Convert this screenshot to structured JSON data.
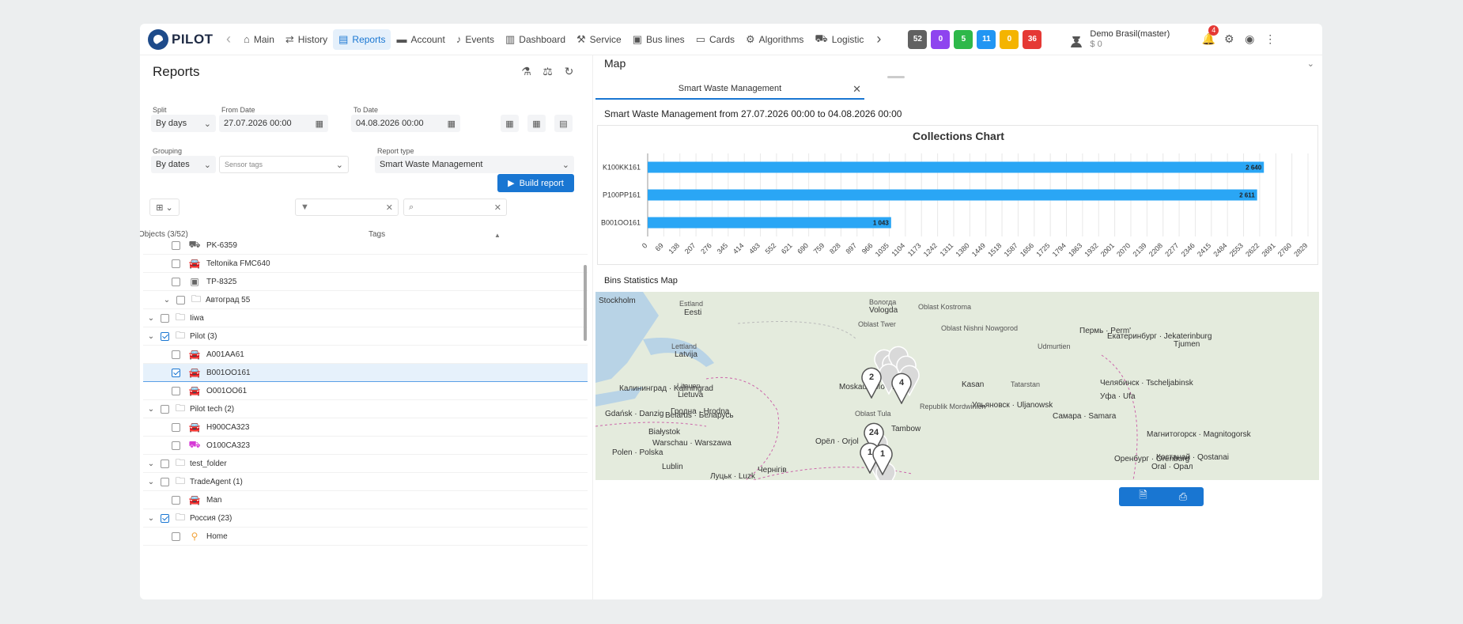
{
  "app": {
    "logo_text": "PILOT"
  },
  "nav": [
    {
      "label": "Main",
      "icon": "home-icon",
      "glyph": "⌂"
    },
    {
      "label": "History",
      "icon": "route-icon",
      "glyph": "⇄"
    },
    {
      "label": "Reports",
      "icon": "report-icon",
      "glyph": "▤",
      "active": true
    },
    {
      "label": "Account",
      "icon": "account-icon",
      "glyph": "▬"
    },
    {
      "label": "Events",
      "icon": "bell-icon",
      "glyph": "♪"
    },
    {
      "label": "Dashboard",
      "icon": "dashboard-icon",
      "glyph": "▥"
    },
    {
      "label": "Service",
      "icon": "wrench-icon",
      "glyph": "⚒"
    },
    {
      "label": "Bus lines",
      "icon": "bus-icon",
      "glyph": "▣"
    },
    {
      "label": "Cards",
      "icon": "card-icon",
      "glyph": "▭"
    },
    {
      "label": "Algorithms",
      "icon": "algorithm-icon",
      "glyph": "⚙"
    },
    {
      "label": "Logistic",
      "icon": "truck-icon",
      "glyph": "⛟"
    }
  ],
  "status_badges": [
    {
      "value": "52",
      "color": "#616161"
    },
    {
      "value": "0",
      "color": "#8e44ef"
    },
    {
      "value": "5",
      "color": "#2eb84a"
    },
    {
      "value": "11",
      "color": "#2196f3"
    },
    {
      "value": "0",
      "color": "#f4b400"
    },
    {
      "value": "36",
      "color": "#e53935"
    }
  ],
  "user": {
    "name": "Demo Brasil(master)",
    "balance": "$ 0",
    "notifications": "4"
  },
  "reports_panel": {
    "title": "Reports",
    "split_label": "Split",
    "split_value": "By days",
    "from_label": "From Date",
    "from_value": "27.07.2026 00:00",
    "to_label": "To Date",
    "to_value": "04.08.2026 00:00",
    "grouping_label": "Grouping",
    "grouping_value": "By dates",
    "sensor_tags_placeholder": "Sensor tags",
    "report_type_label": "Report type",
    "report_type_value": "Smart Waste Management",
    "build_label": "Build report",
    "objects_header": "Objects (3/52)",
    "tags_header": "Tags"
  },
  "tree": [
    {
      "level": 1,
      "label": "PK-6359",
      "icon": "truck-icon",
      "glyph": "⛟",
      "checked": false
    },
    {
      "level": 1,
      "label": "Teltonika FMC640",
      "icon": "car-icon",
      "glyph": "🚘",
      "checked": false
    },
    {
      "level": 1,
      "label": "TP-8325",
      "icon": "bus-icon",
      "glyph": "▣",
      "checked": false
    },
    {
      "level": 1,
      "folder": true,
      "expanded": true,
      "label": "Автоград 55",
      "checked": false
    },
    {
      "level": 0,
      "folder": true,
      "expanded": true,
      "label": "Iiwa",
      "checked": false
    },
    {
      "level": 0,
      "folder": true,
      "expanded": true,
      "label": "Pilot (3)",
      "checked": true
    },
    {
      "level": 1,
      "label": "A001AA61",
      "icon": "car-icon",
      "glyph": "🚘",
      "checked": false
    },
    {
      "level": 1,
      "label": "B001OO161",
      "icon": "car-icon",
      "glyph": "🚘",
      "checked": true,
      "selected": true
    },
    {
      "level": 1,
      "label": "O001OO61",
      "icon": "car-icon",
      "glyph": "🚘",
      "checked": false
    },
    {
      "level": 0,
      "folder": true,
      "expanded": true,
      "label": "Pilot tech (2)",
      "checked": false
    },
    {
      "level": 1,
      "label": "H900CA323",
      "icon": "car-icon",
      "glyph": "🚘",
      "checked": false
    },
    {
      "level": 1,
      "label": "O100CA323",
      "icon": "truck-icon",
      "glyph": "⛟",
      "checked": false,
      "color": "#d63ad6"
    },
    {
      "level": 0,
      "folder": true,
      "expanded": true,
      "label": "test_folder",
      "checked": false
    },
    {
      "level": 0,
      "folder": true,
      "expanded": true,
      "label": "TradeAgent (1)",
      "checked": false
    },
    {
      "level": 1,
      "label": "Man",
      "icon": "car-icon",
      "glyph": "🚘",
      "checked": false
    },
    {
      "level": 0,
      "folder": true,
      "expanded": true,
      "label": "Россия (23)",
      "checked": true
    },
    {
      "level": 1,
      "label": "Home",
      "icon": "location-icon",
      "glyph": "⚲",
      "checked": false,
      "color": "#f2a33a"
    }
  ],
  "map_panel": {
    "title": "Map",
    "tab_label": "Smart Waste Management",
    "report_title": "Smart Waste Management from 27.07.2026 00:00 to 04.08.2026 00:00",
    "bins_title": "Bins Statistics Map"
  },
  "chart_data": {
    "type": "bar",
    "orientation": "horizontal",
    "title": "Collections Chart",
    "categories": [
      "K100KK161",
      "P100PP161",
      "B001OO161"
    ],
    "values": [
      2640,
      2611,
      1043
    ],
    "value_labels": [
      "2 640",
      "2 611",
      "1 043"
    ],
    "xlim": [
      0,
      2829
    ],
    "x_ticks": [
      0,
      69,
      138,
      207,
      276,
      345,
      414,
      483,
      552,
      621,
      690,
      759,
      828,
      897,
      966,
      1035,
      1104,
      1173,
      1242,
      1311,
      1380,
      1449,
      1518,
      1587,
      1656,
      1725,
      1794,
      1863,
      1932,
      2001,
      2070,
      2139,
      2208,
      2277,
      2346,
      2415,
      2484,
      2553,
      2622,
      2691,
      2760,
      2829
    ],
    "grid": true,
    "bar_color": "#2aa6f5"
  },
  "map_labels": [
    {
      "text": "Stockholm",
      "big": true
    },
    {
      "text": "Estland"
    },
    {
      "text": "Eesti",
      "big": true
    },
    {
      "text": "Вологда"
    },
    {
      "text": "Vologda",
      "big": true
    },
    {
      "text": "Oblast Kostroma"
    },
    {
      "text": "Пермь · Perm'",
      "big": true
    },
    {
      "text": "Екатеринбург · Jekaterinburg",
      "big": true
    },
    {
      "text": "Tjumen",
      "big": true
    },
    {
      "text": "Lettland"
    },
    {
      "text": "Latvija",
      "big": true
    },
    {
      "text": "Oblast Twer"
    },
    {
      "text": "Oblast Nishni Nowgorod"
    },
    {
      "text": "Udmurtien"
    },
    {
      "text": "Калининград · Kaliningrad",
      "big": true
    },
    {
      "text": "Litauen"
    },
    {
      "text": "Lietuva",
      "big": true
    },
    {
      "text": "Moskau · Москва",
      "big": true
    },
    {
      "text": "Kasan",
      "big": true
    },
    {
      "text": "Tatarstan"
    },
    {
      "text": "Челябинск · Tscheljabinsk",
      "big": true
    },
    {
      "text": "Уфа · Ufa",
      "big": true
    },
    {
      "text": "Gdańsk · Danzig",
      "big": true
    },
    {
      "text": "Гродна · Hrodna",
      "big": true
    },
    {
      "text": "Belarus · Беларусь",
      "big": true
    },
    {
      "text": "Oblast Tula"
    },
    {
      "text": "Ульяновск · Uljanowsk",
      "big": true
    },
    {
      "text": "Republik Mordwinien"
    },
    {
      "text": "Białystok",
      "big": true
    },
    {
      "text": "Warschau · Warszawa",
      "big": true
    },
    {
      "text": "Polen · Polska",
      "big": true
    },
    {
      "text": "Lublin",
      "big": true
    },
    {
      "text": "Орёл · Orjol",
      "big": true
    },
    {
      "text": "Tambow",
      "big": true
    },
    {
      "text": "Самара · Samara",
      "big": true
    },
    {
      "text": "Оренбург · Orenburg",
      "big": true
    },
    {
      "text": "Магнитогорск · Magnitogorsk",
      "big": true
    },
    {
      "text": "Костанай · Qostanai",
      "big": true
    },
    {
      "text": "Чернігів",
      "big": true
    },
    {
      "text": "Луцьк · Luzk",
      "big": true
    },
    {
      "text": "Oral · Орал",
      "big": true
    }
  ],
  "map_markers": [
    "2",
    "4",
    "24",
    "1",
    "1"
  ]
}
